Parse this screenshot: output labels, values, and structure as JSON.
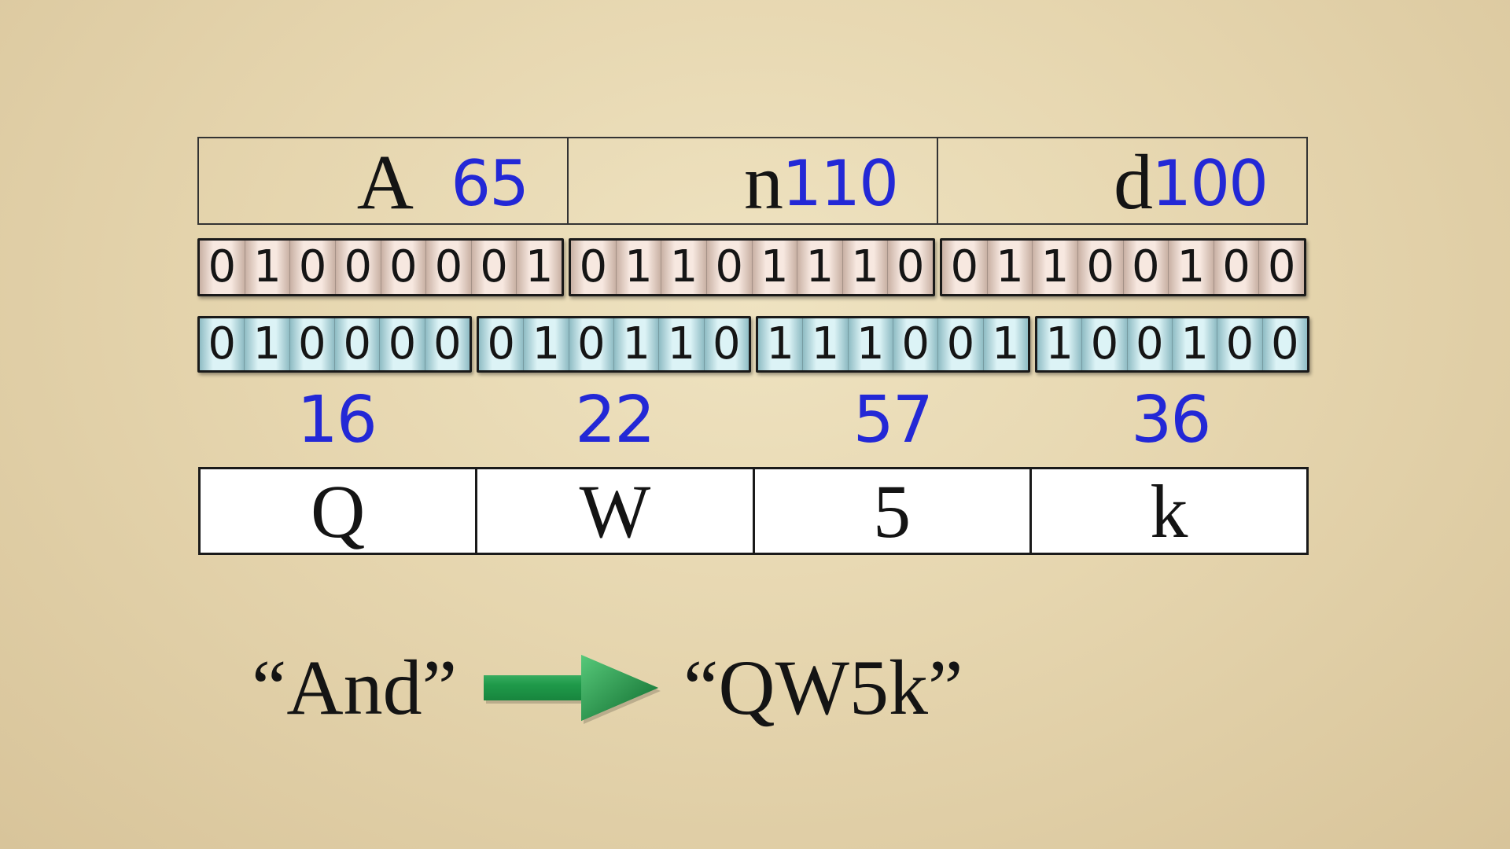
{
  "input_chars": [
    {
      "char": "A",
      "code": "65"
    },
    {
      "char": "n",
      "code": "110"
    },
    {
      "char": "d",
      "code": "100"
    }
  ],
  "bytes": [
    "01000001",
    "01101110",
    "01100100"
  ],
  "sextets": [
    "010000",
    "010110",
    "111001",
    "100100"
  ],
  "indices": [
    "16",
    "22",
    "57",
    "36"
  ],
  "output_chars": [
    "Q",
    "W",
    "5",
    "k"
  ],
  "equation": {
    "input": "“And”",
    "output": "“QW5k”",
    "arrow_icon": "green-right-arrow-icon"
  },
  "colors": {
    "handwriting": "#2328d6",
    "byte_fill": "#f7e8e0",
    "sextet_fill": "#dcf3f6",
    "arrow": "#1f9a4a"
  }
}
